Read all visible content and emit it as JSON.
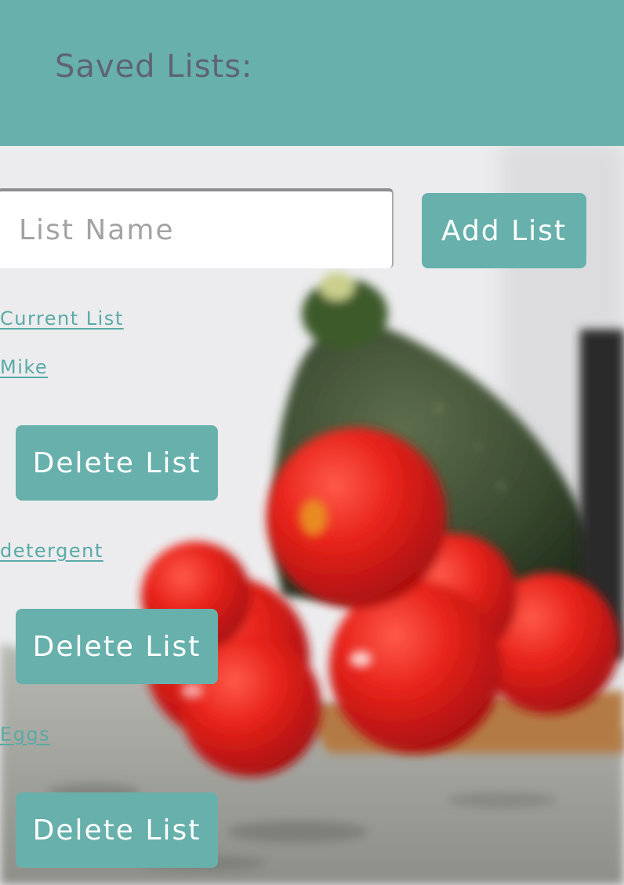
{
  "header": {
    "title": "Saved Lists:"
  },
  "add_list": {
    "input_placeholder": "List Name",
    "input_value": "",
    "button_label": "Add List"
  },
  "current_list_link": "Current List",
  "saved_lists": [
    {
      "name": "Mike",
      "delete_label": "Delete List"
    },
    {
      "name": "detergent",
      "delete_label": "Delete List"
    },
    {
      "name": "Eggs",
      "delete_label": "Delete List"
    }
  ],
  "colors": {
    "accent": "#67b0ac",
    "link": "#5aa9a5",
    "header_text": "#5f6472",
    "background": "#eeeef0"
  }
}
